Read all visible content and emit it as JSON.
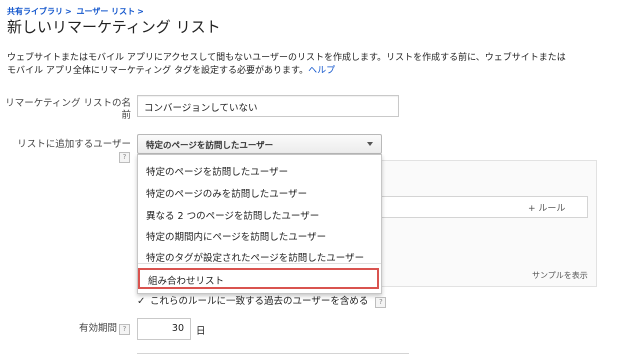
{
  "breadcrumb": {
    "item1": "共有ライブラリ",
    "sep1": ">",
    "item2": "ユーザー リスト",
    "sep2": ">"
  },
  "page": {
    "title": "新しいリマーケティング リスト",
    "description": "ウェブサイトまたはモバイル アプリにアクセスして間もないユーザーのリストを作成します。リストを作成する前に、ウェブサイトまたはモバイル アプリ全体にリマーケティング タグを設定する必要があります。",
    "help_link": "ヘルプ"
  },
  "form": {
    "name_label": "リマーケティング リストの名前",
    "name_value": "コンバージョンしていない",
    "add_label": "リストに追加するユーザー",
    "help_icon": "?",
    "select_value": "特定のページを訪問したユーザー",
    "add_rule": "+ ルール",
    "show_sample": "サンプルを表示",
    "include_past_label": "これらのルールに一致する過去のユーザーを含める",
    "include_past_checked": true,
    "duration_label": "有効期間",
    "duration_value": "30",
    "duration_unit": "日"
  },
  "dropdown": {
    "options": [
      "特定のページを訪問したユーザー",
      "特定のページのみを訪問したユーザー",
      "異なる 2 つのページを訪問したユーザー",
      "特定の期間内にページを訪問したユーザー",
      "特定のタグが設定されたページを訪問したユーザー",
      "組み合わせリスト"
    ],
    "highlighted_index": 5,
    "highlight_color": "#d9534f"
  },
  "colors": {
    "link": "#1155cc"
  }
}
